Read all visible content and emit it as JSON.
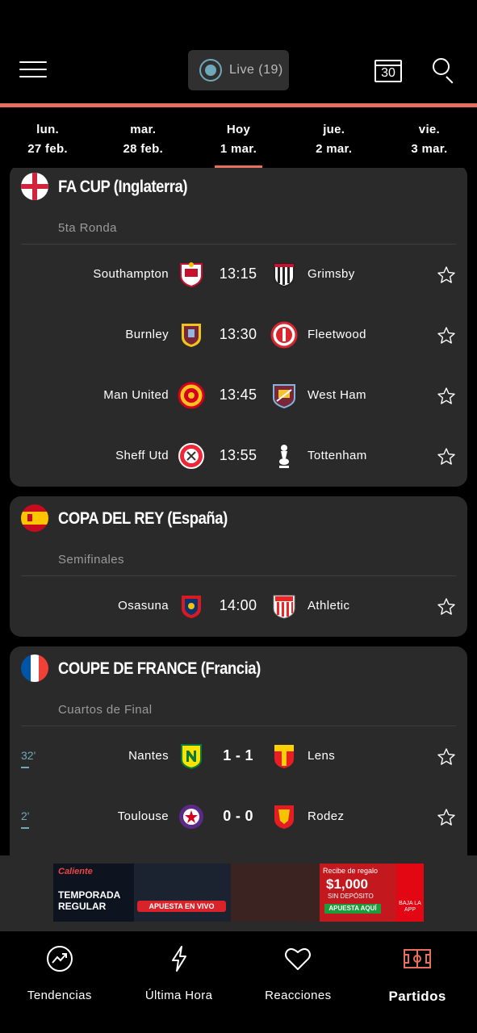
{
  "header": {
    "menu_icon": "hamburger-icon",
    "live_label": "Live (19)",
    "calendar_label": "30",
    "search_icon": "search-icon",
    "accent_color": "#e76f5d"
  },
  "date_tabs": [
    {
      "line1": "lun.",
      "line2": "27 feb."
    },
    {
      "line1": "mar.",
      "line2": "28 feb."
    },
    {
      "line1": "Hoy",
      "line2": "1 mar."
    },
    {
      "line1": "jue.",
      "line2": "2 mar."
    },
    {
      "line1": "vie.",
      "line2": "3 mar."
    }
  ],
  "competitions": [
    {
      "name": "FA CUP (Inglaterra)",
      "round": "5ta Ronda",
      "matches": [
        {
          "home": "Southampton",
          "time": "13:15",
          "away": "Grimsby"
        },
        {
          "home": "Burnley",
          "time": "13:30",
          "away": "Fleetwood"
        },
        {
          "home": "Man United",
          "time": "13:45",
          "away": "West Ham"
        },
        {
          "home": "Sheff Utd",
          "time": "13:55",
          "away": "Tottenham"
        }
      ]
    },
    {
      "name": "COPA DEL REY (España)",
      "round": "Semifinales",
      "matches": [
        {
          "home": "Osasuna",
          "time": "14:00",
          "away": "Athletic"
        }
      ]
    },
    {
      "name": "COUPE DE FRANCE (Francia)",
      "round": "Cuartos de Final",
      "matches": [
        {
          "home": "Nantes",
          "time": "1 - 1",
          "away": "Lens",
          "minute": "32'"
        },
        {
          "home": "Toulouse",
          "time": "0 - 0",
          "away": "Rodez",
          "minute": "2'"
        }
      ]
    }
  ],
  "ad": {
    "brand": "Caliente",
    "headline_1": "TEMPORADA",
    "headline_2": "REGULAR",
    "cta": "APUESTA EN VIVO",
    "offer_top": "Recibe de regalo",
    "offer_amount": "$1,000",
    "offer_sub": "SIN DEPÓSITO",
    "offer_cta": "APUESTA AQUÍ",
    "app_label": "BAJA LA APP"
  },
  "bottom_nav": [
    {
      "label": "Tendencias",
      "icon": "trending-icon"
    },
    {
      "label": "Última Hora",
      "icon": "lightning-icon"
    },
    {
      "label": "Reacciones",
      "icon": "heart-icon"
    },
    {
      "label": "Partidos",
      "icon": "pitch-icon",
      "active": true
    }
  ]
}
